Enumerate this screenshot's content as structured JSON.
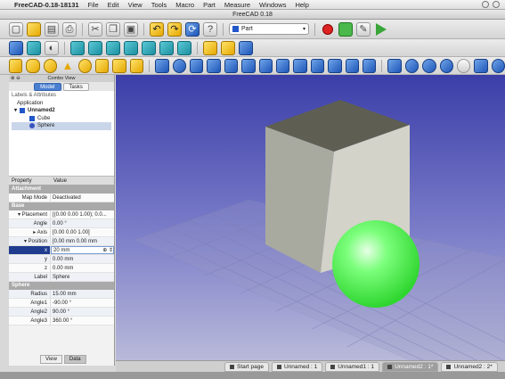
{
  "menubar": {
    "app_name": "FreeCAD-0.18-18131",
    "items": [
      "File",
      "Edit",
      "View",
      "Tools",
      "Macro",
      "Part",
      "Measure",
      "Windows",
      "Help"
    ]
  },
  "window": {
    "title": "FreeCAD 0.18"
  },
  "toolbar": {
    "workbench_selector": "Part",
    "icons": [
      "new-file",
      "open-file",
      "save-file",
      "print",
      "cut",
      "copy",
      "paste",
      "undo",
      "redo",
      "refresh",
      "whats-this",
      "record-macro",
      "stop-macro",
      "edit-macro",
      "run-macro"
    ]
  },
  "combo_view": {
    "title": "Combo View",
    "tabs": [
      "Model",
      "Tasks"
    ],
    "active_tab": "Model",
    "tree_header": "Labels & Attributes",
    "tree_group": "Application",
    "document": "Unnamed2",
    "objects": [
      "Cube",
      "Sphere"
    ],
    "selected_object": "Sphere"
  },
  "property_editor": {
    "columns": [
      "Property",
      "Value"
    ],
    "groups": {
      "attachment": "Attachment",
      "base": "Base",
      "sphere": "Sphere"
    },
    "map_mode": {
      "key": "Map Mode",
      "value": "Deactivated"
    },
    "placement": {
      "key": "Placement",
      "value": "[(0.00 0.00 1.00); 0.0..."
    },
    "angle": {
      "key": "Angle",
      "value": "0.00 °"
    },
    "axis": {
      "key": "Axis",
      "value": "[0.00 0.00 1.00]"
    },
    "position": {
      "key": "Position",
      "value": "[0.00 mm  0.00 mm"
    },
    "x": {
      "key": "x",
      "value": "20 mm"
    },
    "y": {
      "key": "y",
      "value": "0.00 mm"
    },
    "z": {
      "key": "z",
      "value": "0.00 mm"
    },
    "label": {
      "key": "Label",
      "value": "Sphere"
    },
    "radius": {
      "key": "Radius",
      "value": "15.00 mm"
    },
    "angle1": {
      "key": "Angle1",
      "value": "-90.00 °"
    },
    "angle2": {
      "key": "Angle2",
      "value": "90.00 °"
    },
    "angle3": {
      "key": "Angle3",
      "value": "360.00 °"
    }
  },
  "view_tabs": [
    "View",
    "Data"
  ],
  "active_view_tab": "Data",
  "document_tabs": [
    "Start page",
    "Unnamed : 1",
    "Unnamed1 : 1",
    "Unnamed2 : 1*",
    "Unnamed2 : 2*"
  ],
  "colors": {
    "viewport_top": "#3b3ea8",
    "viewport_bottom": "#b9bad9",
    "sphere": "#4dff4d",
    "cube_front": "#d3d3ca",
    "accent": "#2257c9"
  }
}
